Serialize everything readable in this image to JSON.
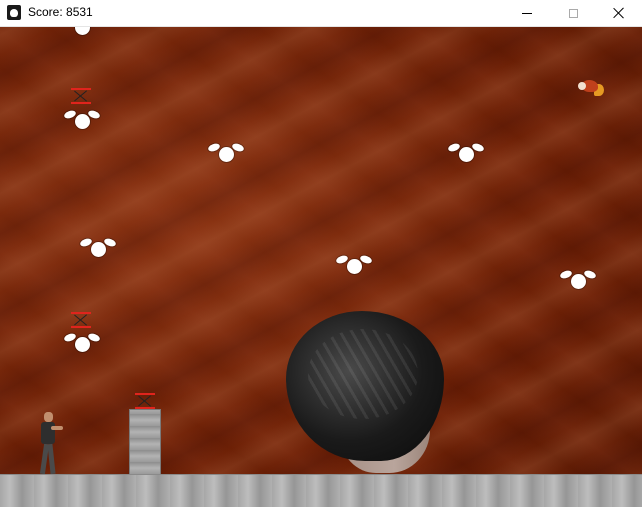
{
  "window": {
    "title": "Score: 8531",
    "app_icon": "skull-app-icon"
  },
  "controls": {
    "minimize": "minimize-icon",
    "maximize": "maximize-icon",
    "close": "close-icon"
  },
  "game": {
    "background_color": "#6b1f05",
    "ground_color": "#a8a8a8",
    "entities": [
      {
        "kind": "skull-enemy"
      },
      {
        "kind": "hourglass-pickup"
      },
      {
        "kind": "skull-enemy"
      },
      {
        "kind": "skull-enemy"
      },
      {
        "kind": "skull-enemy"
      },
      {
        "kind": "bird-enemy"
      },
      {
        "kind": "skull-enemy"
      },
      {
        "kind": "skull-enemy"
      },
      {
        "kind": "skull-enemy"
      },
      {
        "kind": "hourglass-pickup"
      },
      {
        "kind": "skull-enemy"
      },
      {
        "kind": "hourglass-pickup"
      },
      {
        "kind": "stone-pillar"
      },
      {
        "kind": "giant-head-boss"
      },
      {
        "kind": "player-character"
      }
    ]
  }
}
